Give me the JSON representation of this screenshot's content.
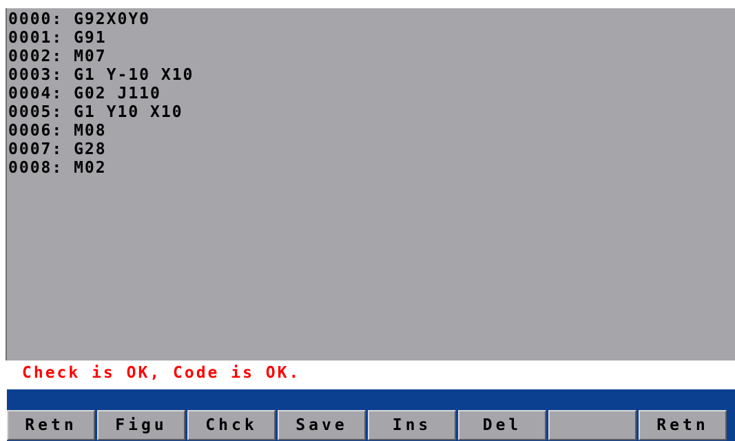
{
  "program": {
    "lines": [
      "0000: G92X0Y0",
      "0001: G91",
      "0002: M07",
      "0003: G1 Y-10 X10",
      "0004: G02 J110",
      "0005: G1 Y10 X10",
      "0006: M08",
      "0007: G28",
      "0008: M02"
    ]
  },
  "status": {
    "message": "Check is OK, Code is OK.",
    "color": "#ff0000"
  },
  "softkeys": [
    {
      "label": "Retn"
    },
    {
      "label": "Figu"
    },
    {
      "label": "Chck"
    },
    {
      "label": "Save"
    },
    {
      "label": "Ins"
    },
    {
      "label": "Del"
    },
    {
      "label": ""
    },
    {
      "label": "Retn"
    }
  ],
  "colors": {
    "panel": "#a6a5aa",
    "softkey_bar": "#0b3f8f",
    "text": "#000000"
  }
}
